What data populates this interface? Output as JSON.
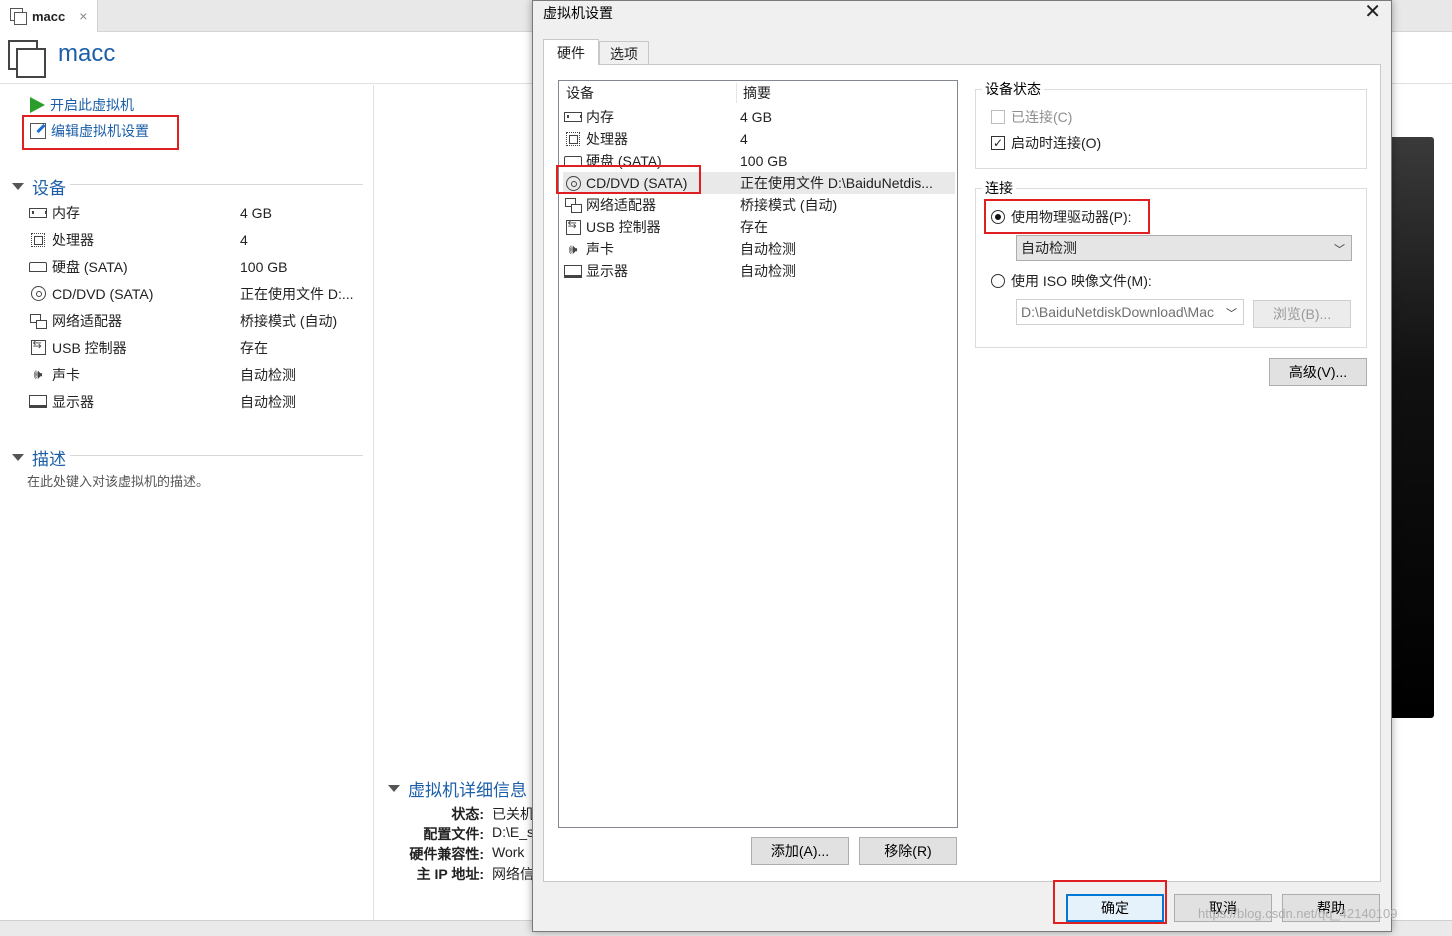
{
  "tab": {
    "label": "macc",
    "close": "×"
  },
  "vm": {
    "title": "macc",
    "actions": {
      "power_on": "开启此虚拟机",
      "edit_settings": "编辑虚拟机设置"
    },
    "devices_header": "设备",
    "devices": [
      {
        "name": "内存",
        "value": "4 GB"
      },
      {
        "name": "处理器",
        "value": "4"
      },
      {
        "name": "硬盘 (SATA)",
        "value": "100 GB"
      },
      {
        "name": "CD/DVD (SATA)",
        "value": "正在使用文件 D:..."
      },
      {
        "name": "网络适配器",
        "value": "桥接模式 (自动)"
      },
      {
        "name": "USB 控制器",
        "value": "存在"
      },
      {
        "name": "声卡",
        "value": "自动检测"
      },
      {
        "name": "显示器",
        "value": "自动检测"
      }
    ],
    "description_header": "描述",
    "description_placeholder": "在此处键入对该虚拟机的描述。",
    "details_header": "虚拟机详细信息",
    "details": [
      {
        "key": "状态:",
        "value": "已关机"
      },
      {
        "key": "配置文件:",
        "value": "D:\\E_s"
      },
      {
        "key": "硬件兼容性:",
        "value": "Work"
      },
      {
        "key": "主 IP 地址:",
        "value": "网络信"
      }
    ]
  },
  "dialog": {
    "title": "虚拟机设置",
    "close": "✕",
    "tabs": [
      {
        "label": "硬件"
      },
      {
        "label": "选项"
      }
    ],
    "list": {
      "col_device": "设备",
      "col_summary": "摘要",
      "rows": [
        {
          "name": "内存",
          "value": "4 GB"
        },
        {
          "name": "处理器",
          "value": "4"
        },
        {
          "name": "硬盘 (SATA)",
          "value": "100 GB"
        },
        {
          "name": "CD/DVD (SATA)",
          "value": "正在使用文件 D:\\BaiduNetdis..."
        },
        {
          "name": "网络适配器",
          "value": "桥接模式 (自动)"
        },
        {
          "name": "USB 控制器",
          "value": "存在"
        },
        {
          "name": "声卡",
          "value": "自动检测"
        },
        {
          "name": "显示器",
          "value": "自动检测"
        }
      ],
      "selected_index": 3
    },
    "add_button": "添加(A)...",
    "remove_button": "移除(R)",
    "device_status": {
      "label": "设备状态",
      "connected": "已连接(C)",
      "connect_at_power_on": "启动时连接(O)"
    },
    "connection": {
      "label": "连接",
      "physical_drive": "使用物理驱动器(P):",
      "drive_select": "自动检测",
      "iso_image": "使用 ISO 映像文件(M):",
      "iso_path": "D:\\BaiduNetdiskDownload\\Mac",
      "browse": "浏览(B)..."
    },
    "advanced_button": "高级(V)...",
    "ok_button": "确定",
    "cancel_button": "取消",
    "help_button": "帮助"
  },
  "watermark": "https://blog.csdn.net/qq_42140109",
  "colors": {
    "link": "#1c5fa8",
    "highlight": "#e02020",
    "accent": "#0078d7",
    "play": "#2a9d2a"
  }
}
